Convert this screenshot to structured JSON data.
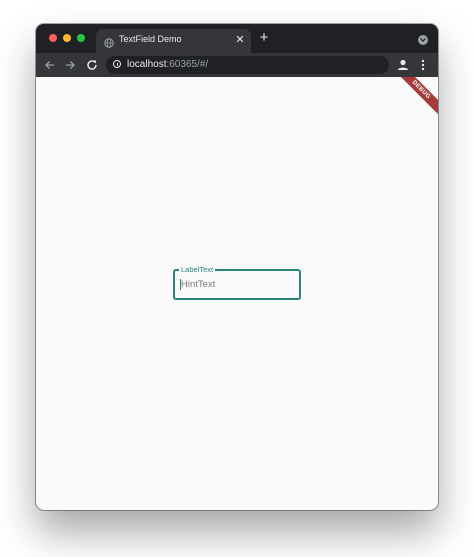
{
  "browser": {
    "tab_title": "TextField Demo",
    "tab_close_glyph": "✕",
    "new_tab_glyph": "+",
    "url_host": "localhost",
    "url_rest": ":60365/#/",
    "icons": {
      "favicon": "globe-icon",
      "back": "arrow-left-icon",
      "forward": "arrow-right-icon",
      "reload": "reload-icon",
      "site_info": "info-icon",
      "bookmark": "star-icon",
      "profile": "profile-icon",
      "menu": "kebab-menu-icon",
      "tab_search": "chevron-down-icon"
    }
  },
  "app": {
    "debug_banner": "DEBUG",
    "text_field": {
      "label": "LabelText",
      "hint": "HintText",
      "accent_color": "#27877b"
    }
  }
}
